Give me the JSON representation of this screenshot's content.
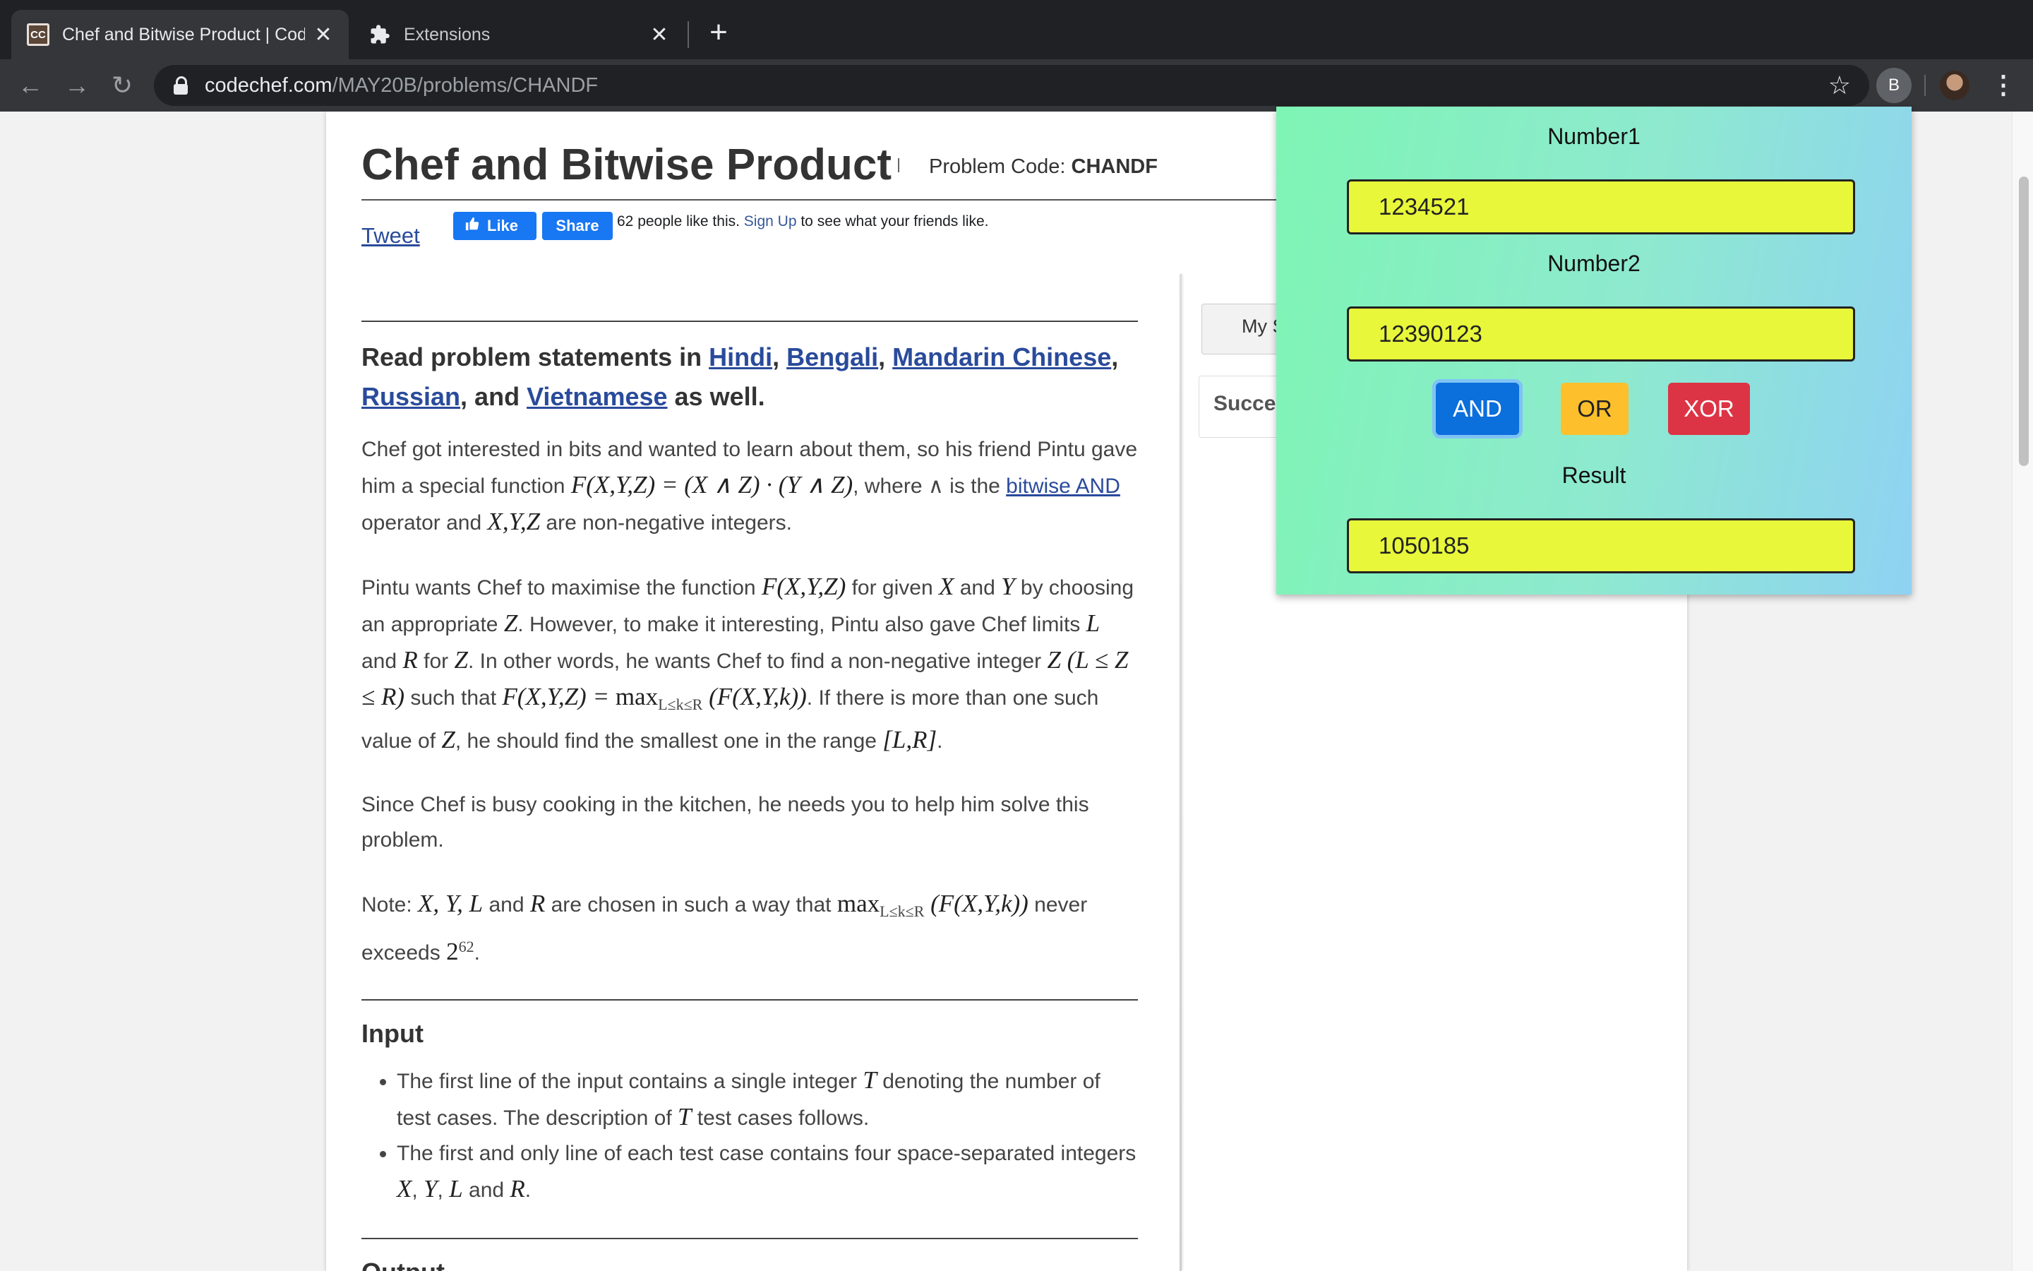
{
  "browser": {
    "tabs": [
      {
        "title": "Chef and Bitwise Product | CodeChef",
        "favicon": "CC",
        "active": true
      },
      {
        "title": "Extensions",
        "icon": "puzzle-icon",
        "active": false
      }
    ],
    "new_tab_symbol": "+",
    "url_host": "codechef.com",
    "url_path": "/MAY20B/problems/CHANDF",
    "profile_initial": "B",
    "nav": {
      "back": "←",
      "forward": "→",
      "reload": "↻"
    },
    "star": "☆",
    "close_symbol": "✕",
    "menu": "⋮"
  },
  "page": {
    "title": "Chef and Bitwise Product",
    "problem_code_label": "Problem Code: ",
    "problem_code": "CHANDF",
    "tweet": "Tweet",
    "fb": {
      "like": "Like",
      "share": "Share",
      "text_before": "62 people like this. ",
      "signup": "Sign Up",
      "text_after": " to see what your friends like."
    },
    "read_statements": {
      "prefix": "Read problem statements in ",
      "languages": [
        "Hindi",
        "Bengali",
        "Mandarin Chinese",
        "Russian",
        "Vietnamese"
      ],
      "and": ", and ",
      "suffix": " as well."
    },
    "para1": {
      "t1": "Chef got interested in bits and wanted to learn about them, so his friend Pintu gave him a special function ",
      "m1": "F(X,Y,Z) = (X ∧ Z) · (Y ∧ Z)",
      "t2": ", where ∧ is the ",
      "link": "bitwise AND",
      "t3": " operator and ",
      "m2": "X,Y,Z",
      "t4": " are non-negative integers."
    },
    "para2": {
      "t1": "Pintu wants Chef to maximise the function ",
      "m1": "F(X,Y,Z)",
      "t2": " for given ",
      "m2": "X",
      "t3": " and ",
      "m3": "Y",
      "t4": " by choosing an appropriate ",
      "m4": "Z",
      "t5": ". However, to make it interesting, Pintu also gave Chef limits ",
      "m5": "L",
      "t6": " and ",
      "m6": "R",
      "t7": " for ",
      "m7": "Z",
      "t8": ". In other words, he wants Chef to find a non-negative integer ",
      "m8": "Z (L ≤ Z ≤ R)",
      "t9": " such that ",
      "m9": "F(X,Y,Z) = ",
      "max": "max",
      "sub": "L≤k≤R",
      "m10": " (F(X,Y,k))",
      "t10": ". If there is more than one such value of ",
      "m11": "Z",
      "t11": ", he should find the smallest one in the range ",
      "m12": "[L,R]",
      "t12": "."
    },
    "para3": "Since Chef is busy cooking in the kitchen, he needs you to help him solve this problem.",
    "para4": {
      "t1": "Note: ",
      "m1": "X, Y, L",
      "t2": " and ",
      "m2": "R",
      "t3": " are chosen in such a way that ",
      "max": "max",
      "sub": "L≤k≤R",
      "m3": " (F(X,Y,k))",
      "t4": " never exceeds ",
      "base": "2",
      "exp": "62",
      "t5": "."
    },
    "input_heading": "Input",
    "input_items": [
      {
        "t1": "The first line of the input contains a single integer ",
        "m": "T",
        "t2": " denoting the number of test cases. The description of ",
        "m2": "T",
        "t3": " test cases follows."
      },
      {
        "t1": "The first and only line of each test case contains four space-separated integers ",
        "m": "X",
        "t2": ", ",
        "m2": "Y",
        "t3": ", ",
        "m3": "L",
        "t4": " and ",
        "m4": "R",
        "t5": "."
      }
    ],
    "output_heading": "Output",
    "sidebar": {
      "button": "My Submissions",
      "box": "Successful Submissions"
    }
  },
  "popup": {
    "number1_label": "Number1",
    "number1_value": "1234521",
    "number2_label": "Number2",
    "number2_value": "12390123",
    "buttons": {
      "and": "AND",
      "or": "OR",
      "xor": "XOR"
    },
    "result_label": "Result",
    "result_value": "1050185",
    "colors": {
      "input_bg": "#e8f73a",
      "and": "#0b6fdc",
      "or": "#fdc02c",
      "xor": "#dd3445"
    }
  }
}
